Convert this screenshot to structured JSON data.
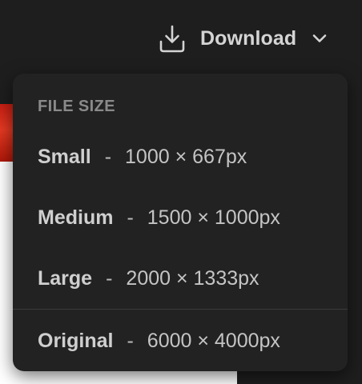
{
  "download": {
    "label": "Download",
    "icon": "download-icon",
    "toggle_icon": "chevron-down-icon"
  },
  "menu": {
    "heading": "FILE SIZE",
    "items": [
      {
        "name": "Small",
        "separator": "-",
        "dimensions": "1000 × 667px"
      },
      {
        "name": "Medium",
        "separator": "-",
        "dimensions": "1500 × 1000px"
      },
      {
        "name": "Large",
        "separator": "-",
        "dimensions": "2000 × 1333px"
      },
      {
        "name": "Original",
        "separator": "-",
        "dimensions": "6000 × 4000px"
      }
    ]
  },
  "colors": {
    "background": "#1e1e1e",
    "menu_background": "#222222",
    "text": "#cfcfcf",
    "heading": "#8a8a8a"
  }
}
